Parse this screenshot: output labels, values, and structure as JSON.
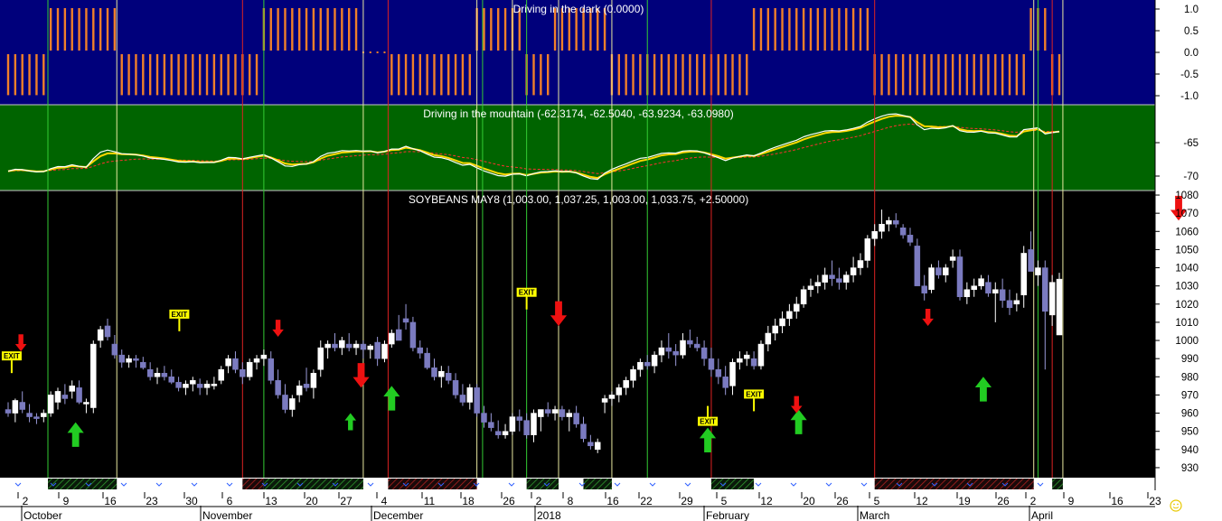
{
  "panels": {
    "dark": {
      "title": "Driving in the dark (0.0000)",
      "bg": "#00007b",
      "ticks": [
        "1.0",
        "0.5",
        "0.0",
        "-0.5",
        "-1.0"
      ],
      "tick_values": [
        1.0,
        0.5,
        0.0,
        -0.5,
        -1.0
      ],
      "bar_color": "#f07f2a"
    },
    "mountain": {
      "title": "Driving in the mountain (-62.3174, -62.5040, -63.9234, -63.0980)",
      "bg": "#006400",
      "ticks": [
        "-65",
        "-70"
      ],
      "tick_values": [
        -65,
        -70
      ]
    },
    "price": {
      "title": "SOYBEANS MAY8 (1,003.00, 1,037.25, 1,003.00, 1,033.75, +2.50000)",
      "bg": "#000000",
      "ticks": [
        "1080",
        "1070",
        "1060",
        "1050",
        "1040",
        "1030",
        "1020",
        "1010",
        "1000",
        "990",
        "980",
        "970",
        "960",
        "950",
        "940",
        "930"
      ]
    }
  },
  "x_axis": {
    "day_labels": [
      "2",
      "9",
      "16",
      "23",
      "30",
      "6",
      "13",
      "20",
      "27",
      "4",
      "11",
      "18",
      "26",
      "2",
      "8",
      "16",
      "22",
      "29",
      "5",
      "12",
      "20",
      "26",
      "5",
      "12",
      "19",
      "26",
      "2",
      "9",
      "16",
      "23"
    ],
    "month_labels": [
      "October",
      "November",
      "December",
      "2018",
      "February",
      "March",
      "April"
    ]
  },
  "signals": {
    "exit_label": "EXIT"
  },
  "colors": {
    "bull_candle": "#ffffff",
    "bear_candle": "#7b7bc0",
    "up_arrow": "#22cc22",
    "down_arrow": "#ee1111",
    "long_line": "#33cc33",
    "short_line": "#dd2222",
    "exit_line": "#e8e8a0",
    "exit_box": "#ffff00"
  },
  "chart_data": {
    "type": "candlestick",
    "title": "SOYBEANS MAY8 (1,003.00, 1,037.25, 1,003.00, 1,033.75, +2.50000)",
    "last_bar": {
      "open": 1003.0,
      "high": 1037.25,
      "low": 1003.0,
      "close": 1033.75,
      "change": 2.5
    },
    "ylim": [
      925,
      1082
    ],
    "bars": [
      [
        962,
        966,
        958,
        960
      ],
      [
        960,
        968,
        955,
        967
      ],
      [
        966,
        972,
        960,
        962
      ],
      [
        960,
        965,
        955,
        958
      ],
      [
        958,
        960,
        954,
        957
      ],
      [
        958,
        962,
        955,
        960
      ],
      [
        960,
        972,
        958,
        970
      ],
      [
        966,
        974,
        962,
        972
      ],
      [
        970,
        976,
        965,
        968
      ],
      [
        972,
        978,
        968,
        975
      ],
      [
        974,
        978,
        965,
        966
      ],
      [
        965,
        968,
        960,
        966
      ],
      [
        963,
        1000,
        960,
        998
      ],
      [
        1000,
        1008,
        996,
        1006
      ],
      [
        1008,
        1012,
        1000,
        1002
      ],
      [
        998,
        1003,
        990,
        992
      ],
      [
        992,
        995,
        985,
        988
      ],
      [
        988,
        992,
        985,
        990
      ],
      [
        990,
        992,
        985,
        989
      ],
      [
        988,
        991,
        984,
        985
      ],
      [
        984,
        988,
        978,
        980
      ],
      [
        980,
        985,
        976,
        982
      ],
      [
        982,
        986,
        978,
        980
      ],
      [
        980,
        984,
        976,
        977
      ],
      [
        977,
        980,
        972,
        974
      ],
      [
        974,
        978,
        970,
        976
      ],
      [
        976,
        980,
        972,
        978
      ],
      [
        976,
        979,
        970,
        974
      ],
      [
        974,
        978,
        970,
        976
      ],
      [
        975,
        980,
        973,
        976
      ],
      [
        978,
        986,
        976,
        984
      ],
      [
        986,
        992,
        982,
        990
      ],
      [
        990,
        994,
        982,
        984
      ],
      [
        984,
        988,
        976,
        980
      ],
      [
        980,
        990,
        978,
        988
      ],
      [
        988,
        992,
        984,
        990
      ],
      [
        990,
        995,
        986,
        992
      ],
      [
        990,
        994,
        976,
        978
      ],
      [
        978,
        984,
        968,
        970
      ],
      [
        970,
        976,
        960,
        962
      ],
      [
        962,
        970,
        958,
        968
      ],
      [
        970,
        978,
        966,
        975
      ],
      [
        976,
        985,
        972,
        974
      ],
      [
        974,
        984,
        968,
        982
      ],
      [
        984,
        1000,
        980,
        996
      ],
      [
        996,
        1000,
        990,
        998
      ],
      [
        998,
        1004,
        994,
        996
      ],
      [
        996,
        1002,
        992,
        1000
      ],
      [
        998,
        1004,
        994,
        996
      ],
      [
        996,
        1000,
        992,
        998
      ],
      [
        998,
        1000,
        990,
        995
      ],
      [
        995,
        998,
        990,
        997
      ],
      [
        999,
        1002,
        986,
        990
      ],
      [
        990,
        1000,
        988,
        998
      ],
      [
        998,
        1006,
        996,
        1004
      ],
      [
        1006,
        1014,
        1002,
        1000
      ],
      [
        1012,
        1020,
        1006,
        1010
      ],
      [
        1010,
        1013,
        994,
        996
      ],
      [
        996,
        1000,
        990,
        993
      ],
      [
        993,
        996,
        984,
        985
      ],
      [
        985,
        990,
        978,
        980
      ],
      [
        980,
        986,
        974,
        983
      ],
      [
        982,
        986,
        976,
        978
      ],
      [
        978,
        982,
        968,
        970
      ],
      [
        970,
        976,
        964,
        966
      ],
      [
        966,
        976,
        962,
        974
      ],
      [
        974,
        976,
        958,
        960
      ],
      [
        960,
        964,
        952,
        955
      ],
      [
        955,
        960,
        950,
        952
      ],
      [
        950,
        956,
        946,
        948
      ],
      [
        948,
        954,
        946,
        950
      ],
      [
        950,
        960,
        948,
        958
      ],
      [
        958,
        962,
        950,
        956
      ],
      [
        956,
        960,
        946,
        948
      ],
      [
        948,
        962,
        944,
        960
      ],
      [
        958,
        962,
        950,
        962
      ],
      [
        962,
        966,
        958,
        960
      ],
      [
        960,
        964,
        956,
        962
      ],
      [
        962,
        964,
        956,
        958
      ],
      [
        958,
        962,
        950,
        960
      ],
      [
        960,
        964,
        952,
        954
      ],
      [
        954,
        958,
        944,
        946
      ],
      [
        944,
        948,
        940,
        942
      ],
      [
        940,
        946,
        938,
        944
      ],
      [
        966,
        970,
        960,
        968
      ],
      [
        968,
        972,
        964,
        970
      ],
      [
        970,
        976,
        966,
        974
      ],
      [
        974,
        980,
        970,
        978
      ],
      [
        978,
        986,
        974,
        984
      ],
      [
        984,
        990,
        980,
        988
      ],
      [
        988,
        992,
        984,
        986
      ],
      [
        986,
        994,
        982,
        992
      ],
      [
        992,
        1000,
        988,
        996
      ],
      [
        996,
        1004,
        990,
        994
      ],
      [
        994,
        998,
        986,
        992
      ],
      [
        992,
        1004,
        990,
        1000
      ],
      [
        1000,
        1006,
        996,
        998
      ],
      [
        998,
        1002,
        994,
        996
      ],
      [
        996,
        1000,
        986,
        990
      ],
      [
        990,
        996,
        980,
        984
      ],
      [
        984,
        990,
        976,
        980
      ],
      [
        980,
        986,
        970,
        974
      ],
      [
        975,
        990,
        970,
        988
      ],
      [
        988,
        994,
        984,
        990
      ],
      [
        990,
        994,
        986,
        992
      ],
      [
        990,
        994,
        984,
        986
      ],
      [
        986,
        1000,
        984,
        998
      ],
      [
        998,
        1008,
        994,
        1004
      ],
      [
        1004,
        1012,
        1000,
        1008
      ],
      [
        1008,
        1016,
        1004,
        1012
      ],
      [
        1012,
        1020,
        1008,
        1016
      ],
      [
        1016,
        1024,
        1012,
        1020
      ],
      [
        1020,
        1030,
        1018,
        1028
      ],
      [
        1028,
        1034,
        1024,
        1030
      ],
      [
        1030,
        1036,
        1026,
        1032
      ],
      [
        1032,
        1040,
        1028,
        1036
      ],
      [
        1036,
        1044,
        1030,
        1034
      ],
      [
        1034,
        1040,
        1028,
        1032
      ],
      [
        1032,
        1038,
        1028,
        1036
      ],
      [
        1036,
        1046,
        1032,
        1040
      ],
      [
        1040,
        1048,
        1036,
        1044
      ],
      [
        1044,
        1058,
        1040,
        1056
      ],
      [
        1056,
        1064,
        1052,
        1060
      ],
      [
        1060,
        1072,
        1056,
        1064
      ],
      [
        1064,
        1068,
        1060,
        1066
      ],
      [
        1066,
        1070,
        1062,
        1064
      ],
      [
        1062,
        1064,
        1056,
        1058
      ],
      [
        1058,
        1062,
        1052,
        1054
      ],
      [
        1052,
        1056,
        1030,
        1030
      ],
      [
        1030,
        1036,
        1022,
        1026
      ],
      [
        1028,
        1042,
        1026,
        1040
      ],
      [
        1040,
        1044,
        1034,
        1036
      ],
      [
        1036,
        1042,
        1032,
        1040
      ],
      [
        1044,
        1050,
        1040,
        1046
      ],
      [
        1046,
        1050,
        1022,
        1024
      ],
      [
        1024,
        1032,
        1020,
        1028
      ],
      [
        1028,
        1034,
        1024,
        1030
      ],
      [
        1030,
        1036,
        1028,
        1034
      ],
      [
        1032,
        1036,
        1024,
        1026
      ],
      [
        1026,
        1032,
        1010,
        1028
      ],
      [
        1028,
        1034,
        1018,
        1022
      ],
      [
        1022,
        1028,
        1014,
        1018
      ],
      [
        1020,
        1026,
        1016,
        1022
      ],
      [
        1025,
        1052,
        1018,
        1048
      ],
      [
        1050,
        1060,
        1040,
        1038
      ],
      [
        1036,
        1044,
        1030,
        1040
      ],
      [
        1040,
        1044,
        984,
        1016
      ],
      [
        1014,
        1036,
        1008,
        1032
      ],
      [
        1003,
        1037.25,
        1003,
        1033.75
      ]
    ]
  }
}
